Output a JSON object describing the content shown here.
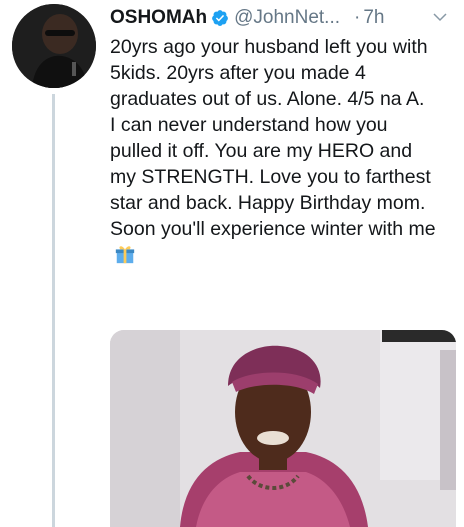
{
  "tweet": {
    "display_name": "OSHOMAh",
    "handle": "@JohnNet...",
    "separator": "·",
    "time": "7h",
    "paragraph1": "20yrs ago your husband left you with 5kids. 20yrs after you made 4 graduates out of us. Alone. 4/5 na A.",
    "paragraph2": "I can never understand how you pulled it off. You are my HERO and my STRENGTH. Love you to farthest star and back. Happy Birthday mom. Soon you'll experience winter with me"
  },
  "colors": {
    "verified_badge": "#1da1f2",
    "secondary_text": "#657786",
    "thread_line": "#ccd6dd"
  },
  "icons": [
    "verified-badge-icon",
    "chevron-down-icon",
    "gift-icon"
  ]
}
